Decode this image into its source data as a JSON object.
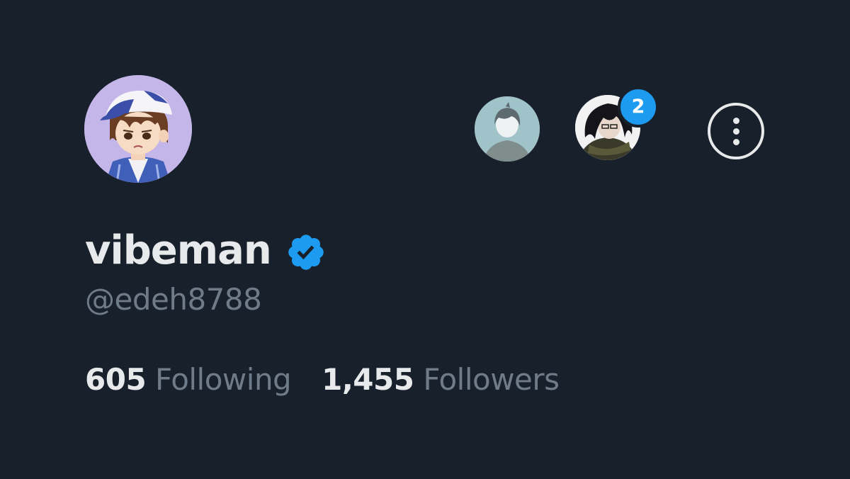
{
  "profile": {
    "display_name": "vibeman",
    "verified": true,
    "handle": "@edeh8788",
    "avatar_icon": "cartoon-boy-cap-avatar"
  },
  "header": {
    "accounts": [
      {
        "avatar_icon": "anime-boy-avatar"
      },
      {
        "avatar_icon": "anime-dark-hair-avatar",
        "badge_count": "2"
      }
    ],
    "more_icon": "more-vertical-icon"
  },
  "stats": {
    "following_count": "605",
    "following_label": "Following",
    "followers_count": "1,455",
    "followers_label": "Followers"
  },
  "colors": {
    "background": "#18202b",
    "text_primary": "#e7e9ea",
    "text_secondary": "#6f7b88",
    "accent": "#1d9bf0"
  }
}
